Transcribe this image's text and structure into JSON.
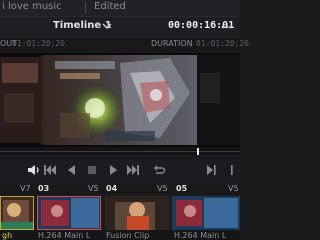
{
  "window": {
    "project_name": "i love music",
    "status": "Edited"
  },
  "header": {
    "timeline_name": "Timeline 1",
    "timecode": "00:00:16:01"
  },
  "infobar": {
    "in_label": "OUT",
    "in_value": "01:01:28:20",
    "duration_label": "DURATION",
    "duration_value": "01:01:28:20"
  },
  "timeline": {
    "tracks": [
      {
        "number": "",
        "badge": "V7",
        "name": "gh"
      },
      {
        "number": "03",
        "badge": "V5",
        "name": "H.264 Main L"
      },
      {
        "number": "04",
        "badge": "V5",
        "name": "Fusion Clip"
      },
      {
        "number": "05",
        "badge": "V5",
        "name": "H.264 Main L"
      }
    ]
  },
  "icons": {
    "chevron": "chevron-down-icon",
    "menu": "more-dots-icon",
    "volume": "volume-icon",
    "first": "skip-to-start-icon",
    "prev": "step-back-icon",
    "stop": "stop-icon",
    "play": "play-icon",
    "last": "skip-to-end-icon",
    "loop": "loop-icon",
    "next_edit": "next-edit-icon"
  },
  "colors": {
    "accent_yellow": "#e9c53b",
    "accent_red": "#d23a3a",
    "active_clip_border": "#e04a4a"
  }
}
